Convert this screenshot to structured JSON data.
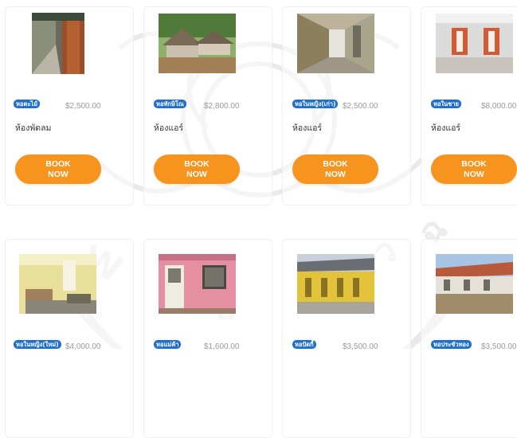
{
  "listings": [
    {
      "badge": "หอตะไม้",
      "price": "$2,500.00",
      "room": "ห้องพัดลม",
      "book_line1": "BOOK",
      "book_line2": "NOW"
    },
    {
      "badge": "หอทักษิโณ",
      "price": "$2,800.00",
      "room": "ห้องแอร์",
      "book_line1": "BOOK",
      "book_line2": "NOW"
    },
    {
      "badge": "หอในหญิง(เก่า)",
      "price": "$2,500.00",
      "room": "ห้องแอร์",
      "book_line1": "BOOK",
      "book_line2": "NOW"
    },
    {
      "badge": "หอในชาย",
      "price": "$8,000.00",
      "room": "ห้องแอร์",
      "book_line1": "BOOK",
      "book_line2": "NOW"
    },
    {
      "badge": "หอในหญิง(ใหม่)",
      "price": "$4,000.00"
    },
    {
      "badge": "หอแม่ค้า",
      "price": "$1,600.00"
    },
    {
      "badge": "หอปัดกี้",
      "price": "$3,500.00"
    },
    {
      "badge": "หอประชัวทอง",
      "price": "$3,500.00"
    }
  ],
  "colors": {
    "badge": "#1f6fd1",
    "button": "#f7941d",
    "price": "#9a9a9a"
  }
}
